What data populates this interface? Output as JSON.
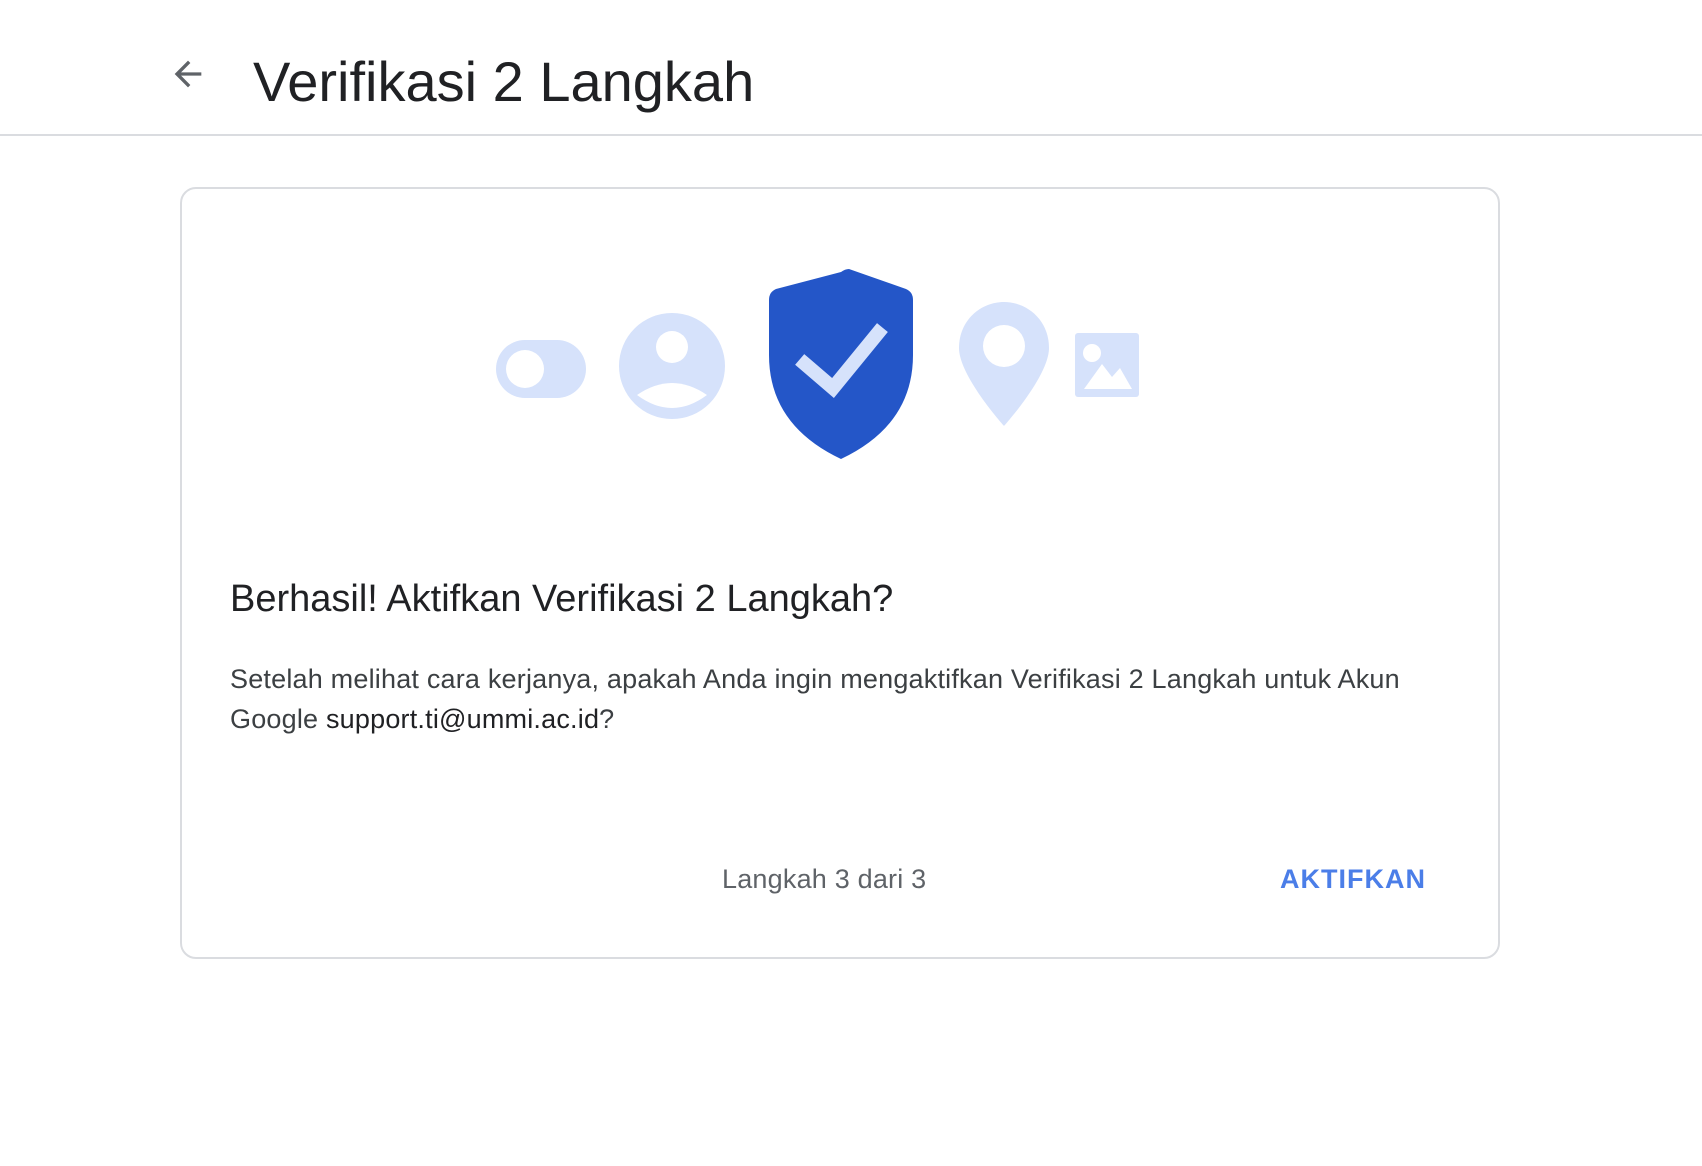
{
  "header": {
    "back_icon": "arrow-back-icon",
    "title": "Verifikasi 2 Langkah"
  },
  "illustration": {
    "icons": [
      "toggle-icon",
      "account-circle-icon",
      "shield-check-icon",
      "location-pin-icon",
      "image-icon"
    ],
    "colors": {
      "light": "#d6e2fb",
      "shield": "#2456c8",
      "check": "#d6e2fb"
    }
  },
  "card": {
    "heading": "Berhasil! Aktifkan Verifikasi 2 Langkah?",
    "body_prefix": "Setelah melihat cara kerjanya, apakah Anda ingin mengaktifkan Verifikasi 2 Langkah untuk Akun Google ",
    "email": "support.ti@ummi.ac.id",
    "body_suffix": "?",
    "step": "Langkah 3 dari 3",
    "activate_label": "AKTIFKAN"
  },
  "colors": {
    "accent": "#4b7ee8",
    "border": "#dadce0",
    "text": "#202124"
  }
}
